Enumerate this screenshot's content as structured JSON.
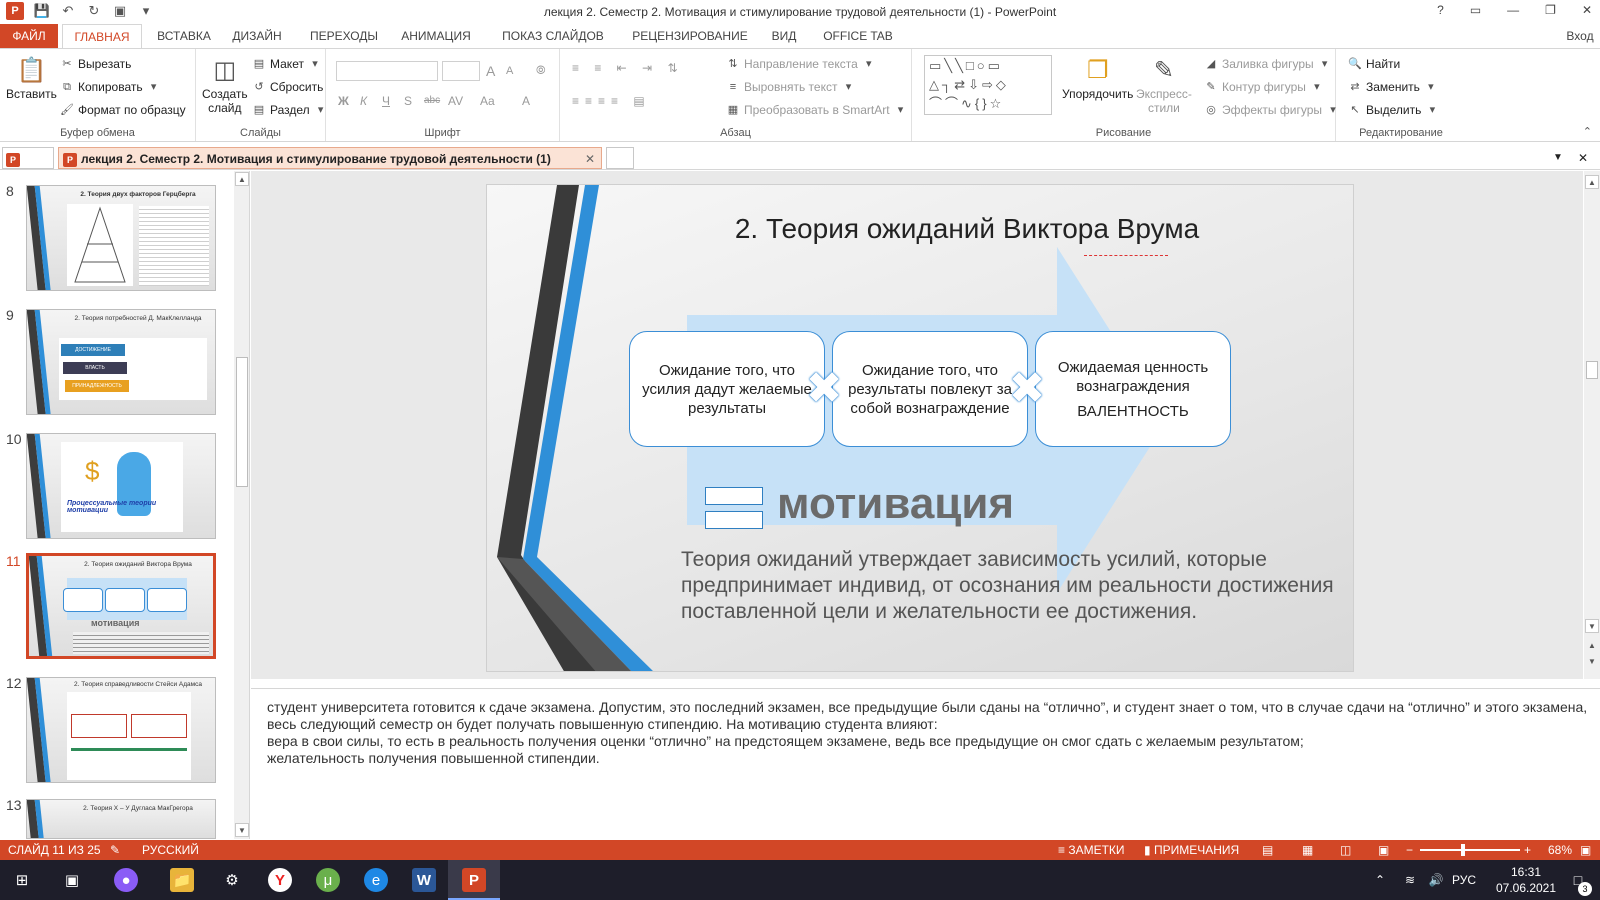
{
  "titlebar": {
    "app_icon_label": "P",
    "title": "лекция 2. Семестр 2. Мотивация и стимулирование трудовой деятельности (1) - PowerPoint",
    "help": "?",
    "minimize": "—",
    "restore": "❐",
    "close": "✕",
    "signin": "Вход"
  },
  "tabs": [
    "ФАЙЛ",
    "ГЛАВНАЯ",
    "ВСТАВКА",
    "ДИЗАЙН",
    "ПЕРЕХОДЫ",
    "АНИМАЦИЯ",
    "ПОКАЗ СЛАЙДОВ",
    "РЕЦЕНЗИРОВАНИЕ",
    "ВИД",
    "OFFICE TAB"
  ],
  "ribbon": {
    "clipboard": {
      "paste": "Вставить",
      "cut": "Вырезать",
      "copy": "Копировать",
      "format_painter": "Формат по образцу",
      "label": "Буфер обмена"
    },
    "slides": {
      "new_slide_1": "Создать",
      "new_slide_2": "слайд",
      "layout": "Макет",
      "reset": "Сбросить",
      "section": "Раздел",
      "label": "Слайды"
    },
    "font": {
      "label": "Шрифт",
      "bold": "Ж",
      "italic": "К",
      "underline": "Ч",
      "shadow": "S",
      "strike": "abc",
      "spacing": "AV",
      "case": "Aa",
      "color": "A",
      "grow": "A",
      "shrink": "A"
    },
    "paragraph": {
      "text_direction": "Направление текста",
      "align_text": "Выровнять текст",
      "smartart": "Преобразовать в SmartArt",
      "label": "Абзац"
    },
    "drawing": {
      "arrange": "Упорядочить",
      "quick_styles_1": "Экспресс-",
      "quick_styles_2": "стили",
      "fill": "Заливка фигуры",
      "outline": "Контур фигуры",
      "effects": "Эффекты фигуры",
      "label": "Рисование"
    },
    "editing": {
      "find": "Найти",
      "replace": "Заменить",
      "select": "Выделить",
      "label": "Редактирование"
    }
  },
  "doc_tab": {
    "title": "лекция 2. Семестр 2. Мотивация и стимулирование трудовой деятельности (1)",
    "close": "✕"
  },
  "thumbnails": [
    {
      "num": "8",
      "title": "2. Теория двух факторов Герцберга"
    },
    {
      "num": "9",
      "title": "2. Теория потребностей Д. МакКлелланда",
      "items": [
        "ДОСТИЖЕНИЕ",
        "ВЛАСТЬ",
        "ПРИНАДЛЕЖНОСТЬ"
      ]
    },
    {
      "num": "10",
      "title": "Процессуальные теории мотивации"
    },
    {
      "num": "11",
      "title": "2. Теория ожиданий Виктора Врума",
      "word": "мотивация"
    },
    {
      "num": "12",
      "title": "2. Теория справедливости Стейси Адамса"
    },
    {
      "num": "13",
      "title": "2. Теория Х – У Дугласа МакГрегора"
    }
  ],
  "slide": {
    "title": "2. Теория ожиданий Виктора Врума",
    "box1": "Ожидание того, что усилия дадут желаемые результаты",
    "box2": "Ожидание того, что результаты повлекут за собой вознаграждение",
    "box3": "Ожидаемая ценность вознаграждения",
    "box3_sub": "ВАЛЕНТНОСТЬ",
    "equals_word": "мотивация",
    "body": "Теория ожиданий утверждает зависимость усилий, которые предпринимает индивид, от осознания им реальности достижения поставленной цели и желательности ее достижения."
  },
  "notes": {
    "line1": "студент университета готовится к сдаче экзамена. Допустим, это последний экзамен, все предыдущие были сданы на “отлично”, и студент знает о том, что в случае сдачи на “отлично” и этого экзамена, весь следующий семестр он будет получать повышенную стипендию. На мотивацию студента влияют:",
    "line2": "вера в свои силы, то есть в реальность получения оценки “отлично” на предстоящем экзамене, ведь все предыдущие он смог сдать с желаемым результатом;",
    "line3": "желательность получения повышенной стипендии."
  },
  "status": {
    "slide_of": "СЛАЙД 11 ИЗ 25",
    "language": "РУССКИЙ",
    "notes": "ЗАМЕТКИ",
    "comments": "ПРИМЕЧАНИЯ",
    "zoom": "68%",
    "zoom_minus": "−",
    "zoom_plus": "+",
    "zoom_level": 0.68
  },
  "taskbar": {
    "lang": "РУС",
    "time": "16:31",
    "date": "07.06.2021",
    "notif_count": "3"
  },
  "colors": {
    "accent": "#d24726",
    "slide_blue": "#2f8fd8",
    "arrow_blue": "#c6e1f7"
  }
}
